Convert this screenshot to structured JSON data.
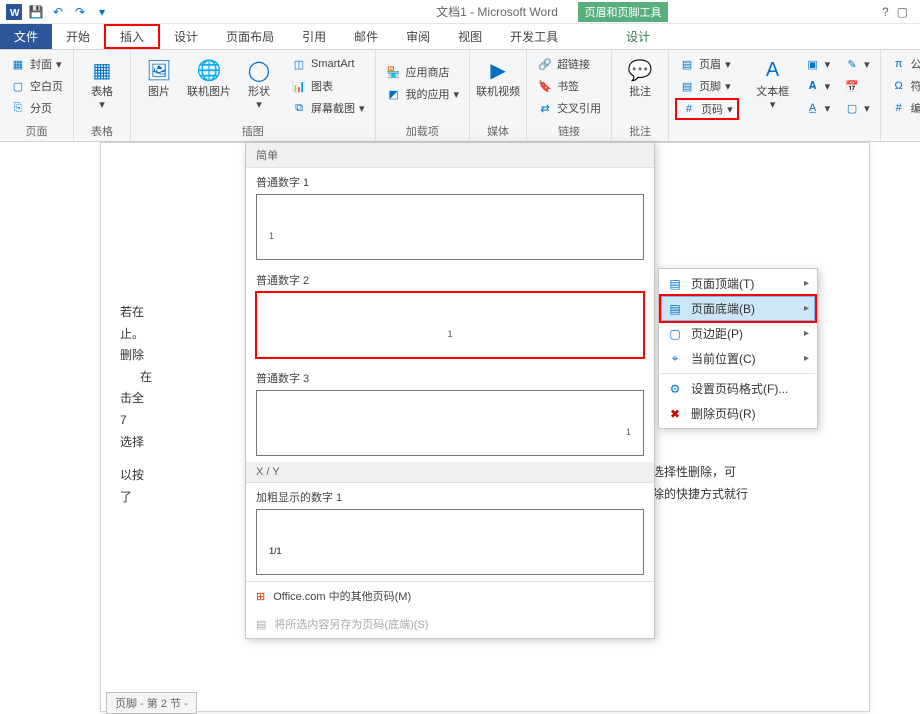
{
  "titlebar": {
    "title": "文档1 - Microsoft Word",
    "context_tool_title": "页眉和页脚工具",
    "help_icon": "?",
    "restore_icon": "▢"
  },
  "tabs": {
    "file": "文件",
    "items": [
      "开始",
      "插入",
      "设计",
      "页面布局",
      "引用",
      "邮件",
      "审阅",
      "视图",
      "开发工具"
    ],
    "context": "设计",
    "active_index": 1
  },
  "ribbon": {
    "group_pages": {
      "label": "页面",
      "cover": "封面",
      "blank": "空白页",
      "break": "分页"
    },
    "group_tables": {
      "label": "表格",
      "btn": "表格"
    },
    "group_illustrations": {
      "label": "插图",
      "pictures": "图片",
      "online_pictures": "联机图片",
      "shapes": "形状",
      "smartart": "SmartArt",
      "chart": "图表",
      "screenshot": "屏幕截图"
    },
    "group_addins": {
      "label": "加载项",
      "store": "应用商店",
      "myapps": "我的应用"
    },
    "group_media": {
      "label": "媒体",
      "video": "联机视频"
    },
    "group_links": {
      "label": "链接",
      "hyperlink": "超链接",
      "bookmark": "书签",
      "crossref": "交叉引用"
    },
    "group_comments": {
      "label": "批注",
      "btn": "批注"
    },
    "group_headerfooter": {
      "header": "页眉",
      "footer": "页脚",
      "pagenum": "页码"
    },
    "group_text": {
      "textbox": "文本框"
    },
    "group_symbols": {
      "equation": "公式",
      "symbol": "符号",
      "number": "编号"
    }
  },
  "submenu": {
    "items": [
      {
        "label": "页面顶端(T)",
        "arrow": true
      },
      {
        "label": "页面底端(B)",
        "arrow": true,
        "highlighted": true,
        "hover": true
      },
      {
        "label": "页边距(P)",
        "arrow": true
      },
      {
        "label": "当前位置(C)",
        "arrow": true
      },
      {
        "label": "设置页码格式(F)...",
        "arrow": false
      },
      {
        "label": "删除页码(R)",
        "arrow": false
      }
    ]
  },
  "gallery": {
    "header": "简单",
    "items": [
      {
        "label": "普通数字 1",
        "align": "left"
      },
      {
        "label": "普通数字 2",
        "align": "center",
        "selected": true
      },
      {
        "label": "普通数字 3",
        "align": "right"
      }
    ],
    "section2_header": "X / Y",
    "section2_item_label": "加粗显示的数字 1",
    "footer_more": "Office.com 中的其他页码(M)",
    "footer_save": "将所选内容另存为页码(底端)(S)"
  },
  "document": {
    "lines": [
      "若在",
      "止。",
      "删除",
      "在",
      "击全",
      "7",
      "选择",
      "以按",
      "了"
    ],
    "right_lines": [
      "要选择性删除，可",
      "删除的快捷方式就行"
    ],
    "footer_tag": "页脚 - 第 2 节 -"
  }
}
